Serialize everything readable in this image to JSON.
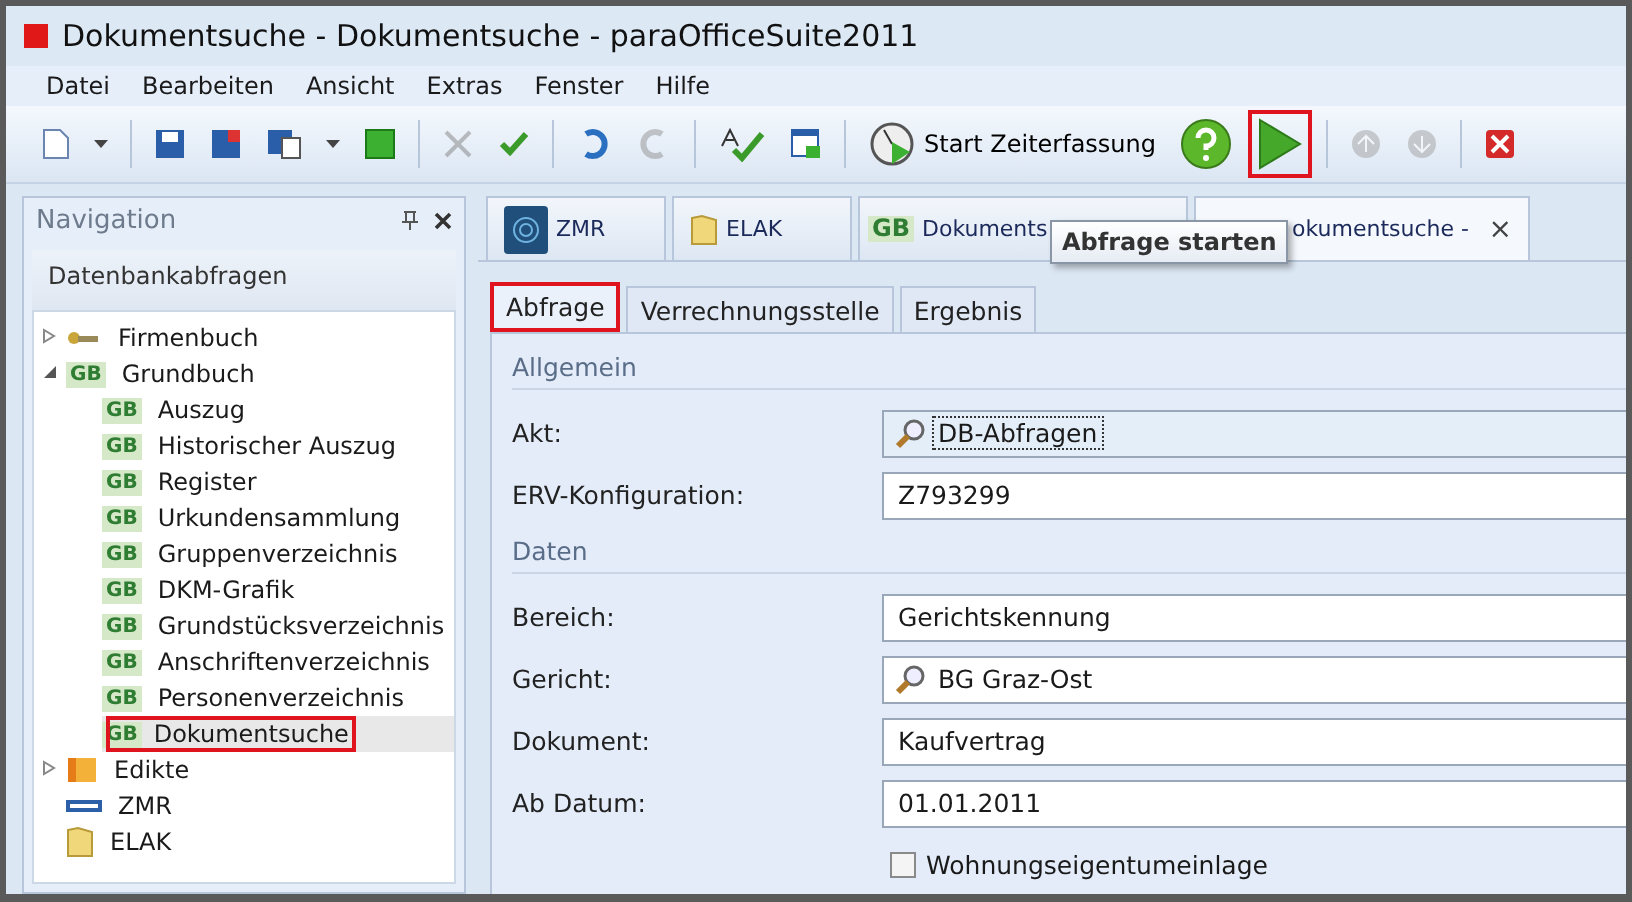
{
  "window": {
    "title": "Dokumentsuche - Dokumentsuche - paraOfficeSuite2011"
  },
  "menu": [
    "Datei",
    "Bearbeiten",
    "Ansicht",
    "Extras",
    "Fenster",
    "Hilfe"
  ],
  "toolbar": [
    {
      "kind": "new",
      "disabled": false,
      "annotated": false
    },
    {
      "kind": "dropdown",
      "disabled": false,
      "annotated": false
    },
    {
      "kind": "sep"
    },
    {
      "kind": "save",
      "disabled": false,
      "annotated": false
    },
    {
      "kind": "save-close",
      "disabled": false,
      "annotated": false
    },
    {
      "kind": "save-as",
      "disabled": false,
      "annotated": false
    },
    {
      "kind": "dropdown",
      "disabled": false,
      "annotated": false
    },
    {
      "kind": "green-square",
      "disabled": false,
      "annotated": false
    },
    {
      "kind": "sep"
    },
    {
      "kind": "cancel",
      "disabled": true,
      "annotated": false
    },
    {
      "kind": "accept",
      "disabled": false,
      "annotated": false
    },
    {
      "kind": "sep"
    },
    {
      "kind": "undo",
      "disabled": false,
      "annotated": false
    },
    {
      "kind": "redo",
      "disabled": true,
      "annotated": false
    },
    {
      "kind": "sep"
    },
    {
      "kind": "spell",
      "disabled": false,
      "annotated": false
    },
    {
      "kind": "form",
      "disabled": false,
      "annotated": false
    },
    {
      "kind": "sep"
    },
    {
      "kind": "timer",
      "label": "Start Zeiterfassung",
      "disabled": false,
      "annotated": false
    },
    {
      "kind": "help",
      "disabled": false,
      "annotated": false
    },
    {
      "kind": "run",
      "disabled": false,
      "annotated": true
    },
    {
      "kind": "sep"
    },
    {
      "kind": "up",
      "disabled": true,
      "annotated": false
    },
    {
      "kind": "down",
      "disabled": true,
      "annotated": false
    },
    {
      "kind": "sep"
    },
    {
      "kind": "close",
      "disabled": false,
      "annotated": false
    }
  ],
  "navigation": {
    "title": "Navigation",
    "section": "Datenbankabfragen",
    "tree": [
      {
        "label": "Firmenbuch",
        "kind": "keys",
        "expanded": false,
        "selected": false,
        "annotated": false
      },
      {
        "label": "Grundbuch",
        "kind": "gb",
        "badge": "GB",
        "expanded": true,
        "selected": false,
        "annotated": false,
        "children": [
          {
            "label": "Auszug",
            "kind": "gb",
            "badge": "GB",
            "selected": false,
            "annotated": false
          },
          {
            "label": "Historischer Auszug",
            "kind": "gb",
            "badge": "GB",
            "selected": false,
            "annotated": false
          },
          {
            "label": "Register",
            "kind": "gb",
            "badge": "GB",
            "selected": false,
            "annotated": false
          },
          {
            "label": "Urkundensammlung",
            "kind": "gb",
            "badge": "GB",
            "selected": false,
            "annotated": false
          },
          {
            "label": "Gruppenverzeichnis",
            "kind": "gb",
            "badge": "GB",
            "selected": false,
            "annotated": false
          },
          {
            "label": "DKM-Grafik",
            "kind": "gb",
            "badge": "GB",
            "selected": false,
            "annotated": false
          },
          {
            "label": "Grundstücksverzeichnis",
            "kind": "gb",
            "badge": "GB",
            "selected": false,
            "annotated": false
          },
          {
            "label": "Anschriftenverzeichnis",
            "kind": "gb",
            "badge": "GB",
            "selected": false,
            "annotated": false
          },
          {
            "label": "Personenverzeichnis",
            "kind": "gb",
            "badge": "GB",
            "selected": false,
            "annotated": false
          },
          {
            "label": "Dokumentsuche",
            "kind": "gb",
            "badge": "GB",
            "selected": true,
            "annotated": true
          }
        ]
      },
      {
        "label": "Edikte",
        "kind": "ed",
        "expanded": false,
        "selected": false,
        "annotated": false
      },
      {
        "label": "ZMR",
        "kind": "zmr",
        "selected": false,
        "annotated": false
      },
      {
        "label": "ELAK",
        "kind": "folder",
        "selected": false,
        "annotated": false
      }
    ]
  },
  "doc_tabs": [
    {
      "label": "ZMR",
      "kind": "fingerprint",
      "selected": false
    },
    {
      "label": "ELAK",
      "kind": "folder",
      "selected": false
    },
    {
      "label": "Dokuments",
      "kind": "gb",
      "badge": "GB",
      "selected": false
    },
    {
      "label": "okumentsuche -",
      "kind": "covered",
      "selected": true,
      "close": "×"
    }
  ],
  "tooltip": "Abfrage starten",
  "sub_tabs": [
    {
      "label": "Abfrage",
      "selected": true,
      "annotated": true
    },
    {
      "label": "Verrechnungsstelle",
      "selected": false,
      "annotated": false
    },
    {
      "label": "Ergebnis",
      "selected": false,
      "annotated": false
    }
  ],
  "sections": [
    {
      "title": "Allgemein",
      "fields": [
        {
          "kind": "lookup",
          "label": "Akt:",
          "value": "DB-Abfragen",
          "focused": true
        },
        {
          "kind": "text",
          "label": "ERV-Konfiguration:",
          "value": "Z793299",
          "focused": false
        }
      ]
    },
    {
      "title": "Daten",
      "fields": [
        {
          "kind": "text",
          "label": "Bereich:",
          "value": "Gerichtskennung",
          "focused": false
        },
        {
          "kind": "lookup",
          "label": "Gericht:",
          "value": "BG Graz-Ost",
          "focused": false
        },
        {
          "kind": "text",
          "label": "Dokument:",
          "value": "Kaufvertrag",
          "focused": false
        },
        {
          "kind": "text",
          "label": "Ab Datum:",
          "value": "01.01.2011",
          "focused": false
        },
        {
          "kind": "checkbox",
          "label": "Wohnungseigentumeinlage",
          "checked": false
        }
      ]
    }
  ]
}
